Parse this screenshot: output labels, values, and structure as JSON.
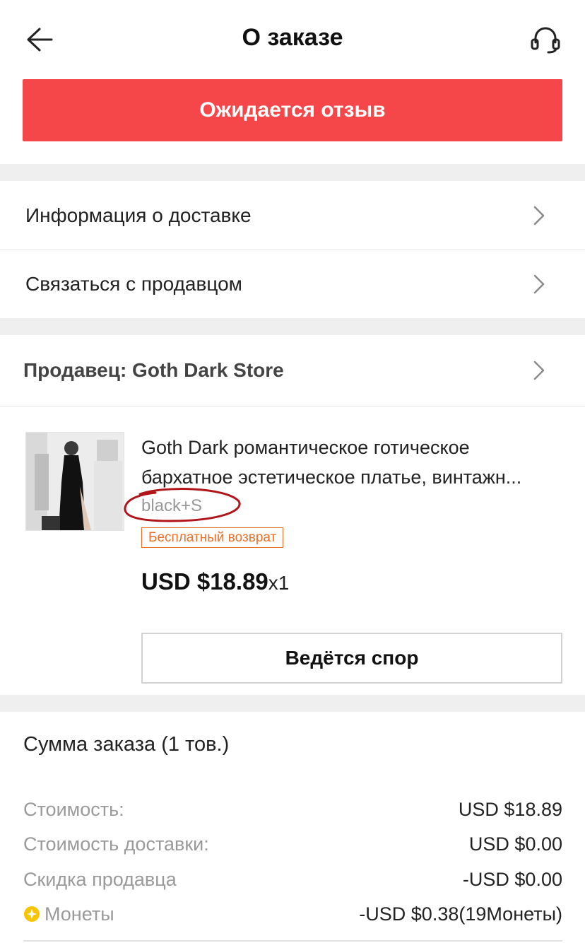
{
  "header": {
    "title": "О заказе",
    "back_icon": "arrow-left-icon",
    "support_icon": "headset-icon"
  },
  "status": {
    "label": "Ожидается отзыв",
    "color": "#f5474a"
  },
  "menu": {
    "delivery_info": "Информация о доставке",
    "contact_seller": "Связаться с продавцом"
  },
  "seller": {
    "label": "Продавец: Goth Dark Store"
  },
  "product": {
    "title_line1": "Goth Dark романтическое готическое",
    "title_line2": "бархатное эстетическое платье, винтажн...",
    "variant": "black+S",
    "badge": "Бесплатный возврат",
    "badge_color": "#e8702a",
    "price": "USD $18.89",
    "quantity": "x1",
    "dispute_button": "Ведётся спор"
  },
  "summary": {
    "title": "Сумма заказа (1 тов.)",
    "rows": [
      {
        "label": "Стоимость:",
        "value": "USD $18.89"
      },
      {
        "label": "Стоимость доставки:",
        "value": "USD $0.00"
      },
      {
        "label": "Скидка продавца",
        "value": "-USD $0.00"
      },
      {
        "label": "Монеты",
        "value": "-USD $0.38(19Монеты)",
        "icon": "coin-icon"
      }
    ]
  }
}
